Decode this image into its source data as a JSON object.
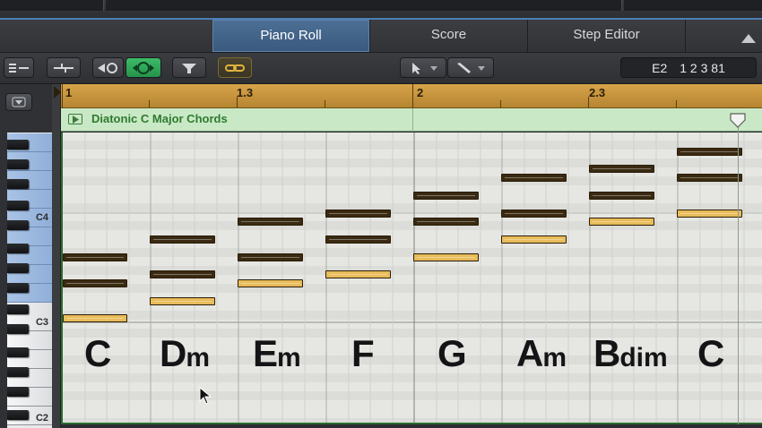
{
  "tabs": [
    {
      "label": "Piano Roll",
      "active": true
    },
    {
      "label": "Score",
      "active": false
    },
    {
      "label": "Step Editor",
      "active": false
    }
  ],
  "toolbar": {
    "buttons": [
      "local-menu-icon",
      "midi-in-icon",
      "catch-icon",
      "link-icon",
      "filter-icon",
      "chain-icon",
      "pointer-tool-icon",
      "pencil-tool-icon"
    ],
    "accent_green": "#2fae5a",
    "accent_gold": "#c9a032"
  },
  "position": {
    "pitch": "E2",
    "time": "1 2 3 81"
  },
  "ruler": {
    "marks": [
      "1",
      "1.3",
      "2",
      "2.3"
    ],
    "color": "#c7953f"
  },
  "region": {
    "name": "Diatonic C Major Chords",
    "color": "#c9e9c6"
  },
  "keyboard": {
    "labels": [
      "C4",
      "C3",
      "C2"
    ]
  },
  "chords": [
    {
      "root": "C",
      "suffix": ""
    },
    {
      "root": "D",
      "suffix": "m"
    },
    {
      "root": "E",
      "suffix": "m"
    },
    {
      "root": "F",
      "suffix": ""
    },
    {
      "root": "G",
      "suffix": ""
    },
    {
      "root": "A",
      "suffix": "m"
    },
    {
      "root": "B",
      "suffix": "dim"
    },
    {
      "root": "C",
      "suffix": ""
    }
  ],
  "notes": [
    {
      "chord": 0,
      "pitches": [
        "C3",
        "E3",
        "G3"
      ],
      "selected_pitch": "C3"
    },
    {
      "chord": 1,
      "pitches": [
        "D3",
        "F3",
        "A3"
      ],
      "selected_pitch": "D3"
    },
    {
      "chord": 2,
      "pitches": [
        "E3",
        "G3",
        "B3"
      ],
      "selected_pitch": "E3"
    },
    {
      "chord": 3,
      "pitches": [
        "F3",
        "A3",
        "C4"
      ],
      "selected_pitch": "F3"
    },
    {
      "chord": 4,
      "pitches": [
        "G3",
        "B3",
        "D4"
      ],
      "selected_pitch": "G3"
    },
    {
      "chord": 5,
      "pitches": [
        "A3",
        "C4",
        "E4"
      ],
      "selected_pitch": "A3"
    },
    {
      "chord": 6,
      "pitches": [
        "B3",
        "D4",
        "F4"
      ],
      "selected_pitch": "B3"
    },
    {
      "chord": 7,
      "pitches": [
        "C4",
        "E4",
        "G4"
      ],
      "selected_pitch": "C4"
    }
  ],
  "colors": {
    "note_dark": "#3a2a12",
    "note_selected": "#e9bc5a",
    "keyboard_highlight": "#9fbbe2",
    "tab_active": "#44668c"
  }
}
